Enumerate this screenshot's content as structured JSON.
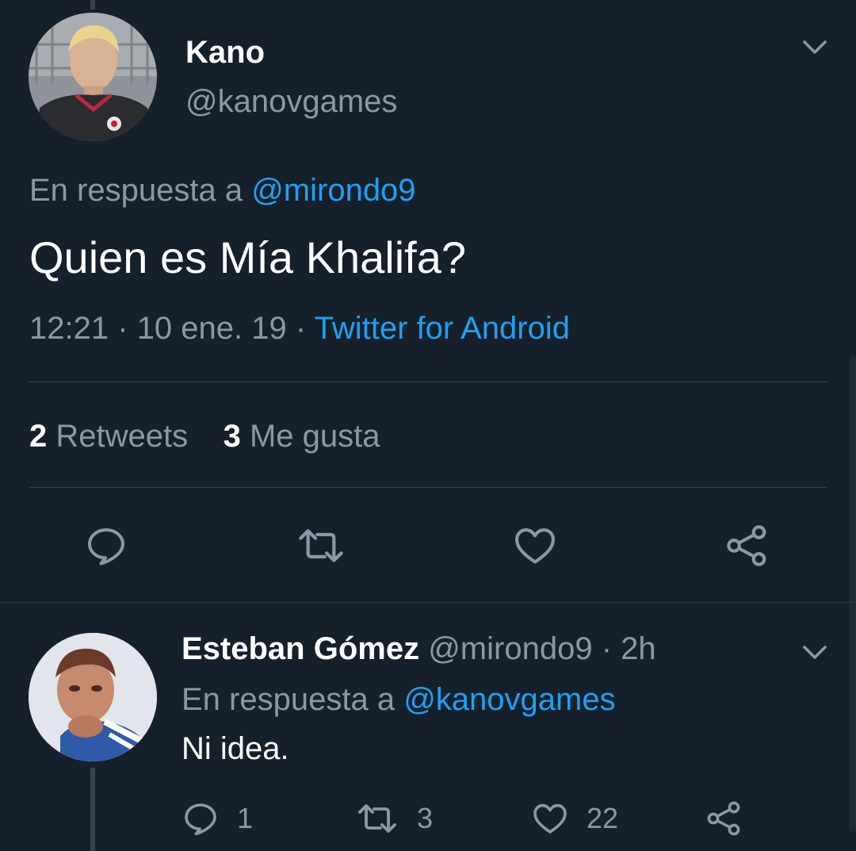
{
  "main_tweet": {
    "author_name": "Kano",
    "author_handle": "@kanovgames",
    "reply_prefix": "En respuesta a",
    "reply_to_handle": "@mirondo9",
    "text": "Quien es Mía Khalifa?",
    "time": "12:21",
    "sep1": "·",
    "date": "10 ene. 19",
    "sep2": "·",
    "source": "Twitter for Android",
    "retweets_count": "2",
    "retweets_label": "Retweets",
    "likes_count": "3",
    "likes_label": "Me gusta"
  },
  "reply_tweet": {
    "author_name": "Esteban Gómez",
    "author_handle": "@mirondo9",
    "time_sep": "·",
    "time_ago": "2h",
    "reply_prefix": "En respuesta a",
    "reply_to_handle": "@kanovgames",
    "text": "Ni idea.",
    "replies_count": "1",
    "retweets_count": "3",
    "likes_count": "22"
  },
  "colors": {
    "background": "#15202b",
    "primary_text": "#ffffff",
    "secondary_text": "#8899a6",
    "accent": "#1da1f2",
    "divider": "#38444d"
  },
  "icons": [
    "comment-icon",
    "retweet-icon",
    "heart-icon",
    "share-icon",
    "chevron-down-icon"
  ]
}
